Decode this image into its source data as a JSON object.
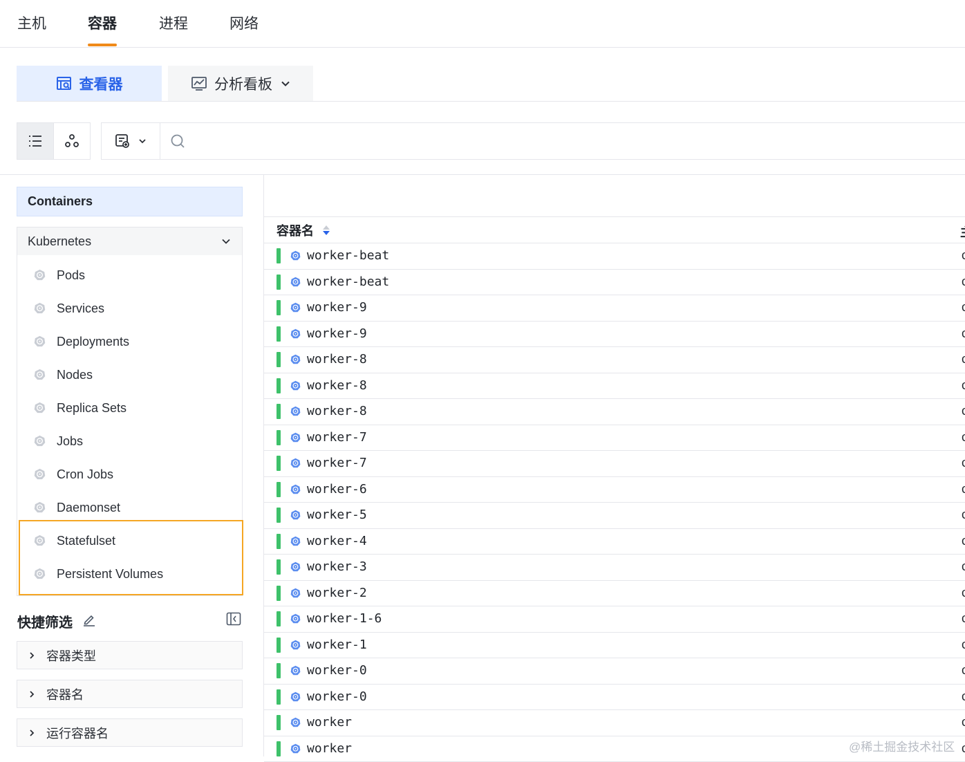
{
  "top_tabs": [
    "主机",
    "容器",
    "进程",
    "网络"
  ],
  "view_tabs": {
    "viewer": "查看器",
    "dashboard": "分析看板"
  },
  "search": {
    "placeholder": ""
  },
  "sidebar": {
    "containers_label": "Containers",
    "kubernetes_label": "Kubernetes",
    "items": [
      "Pods",
      "Services",
      "Deployments",
      "Nodes",
      "Replica Sets",
      "Jobs",
      "Cron Jobs",
      "Daemonset",
      "Statefulset",
      "Persistent Volumes"
    ],
    "quick_filter_title": "快捷筛选",
    "quick_filters": [
      "容器类型",
      "容器名",
      "运行容器名"
    ]
  },
  "table": {
    "column_header": "容器名",
    "next_column_header_fragment": "主",
    "next_column_fragment": "c",
    "rows": [
      "worker-beat",
      "worker-beat",
      "worker-9",
      "worker-9",
      "worker-8",
      "worker-8",
      "worker-8",
      "worker-7",
      "worker-7",
      "worker-6",
      "worker-5",
      "worker-4",
      "worker-3",
      "worker-2",
      "worker-1-6",
      "worker-1",
      "worker-0",
      "worker-0",
      "worker",
      "worker"
    ],
    "status_color": "#3ec16a"
  },
  "colors": {
    "accent": "#2a63e8",
    "tab_underline": "#f08a1a",
    "highlight": "#f5a623"
  },
  "watermark": "@稀土掘金技术社区"
}
